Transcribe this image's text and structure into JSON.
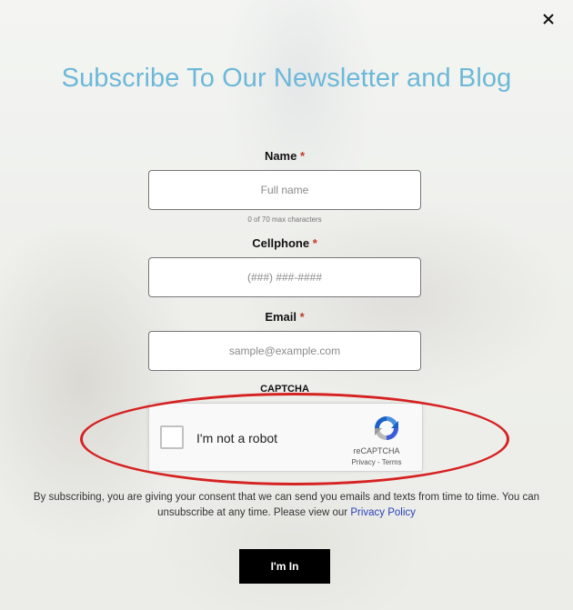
{
  "popup": {
    "title": "Subscribe To Our Newsletter and Blog",
    "close_icon": "close-icon"
  },
  "form": {
    "name": {
      "label": "Name",
      "required_mark": "*",
      "placeholder": "Full name",
      "value": "",
      "hint": "0 of 70 max characters"
    },
    "cellphone": {
      "label": "Cellphone",
      "required_mark": "*",
      "placeholder": "(###) ###-####",
      "value": ""
    },
    "email": {
      "label": "Email",
      "required_mark": "*",
      "placeholder": "sample@example.com",
      "value": ""
    },
    "captcha": {
      "label": "CAPTCHA",
      "checkbox_text": "I'm not a robot",
      "brand": "reCAPTCHA",
      "privacy": "Privacy",
      "separator": " - ",
      "terms": "Terms",
      "icon": "recaptcha-logo-icon"
    },
    "consent": {
      "text": "By subscribing, you are giving your consent that we can send you emails and texts from time to time. You can unsubscribe at any time. Please view our ",
      "link": "Privacy Policy"
    },
    "submit_label": "I'm In"
  },
  "colors": {
    "title": "#6db8d9",
    "required": "#c0392b",
    "annotation": "#d62121",
    "link": "#2a3fb8",
    "button": "#000000"
  }
}
